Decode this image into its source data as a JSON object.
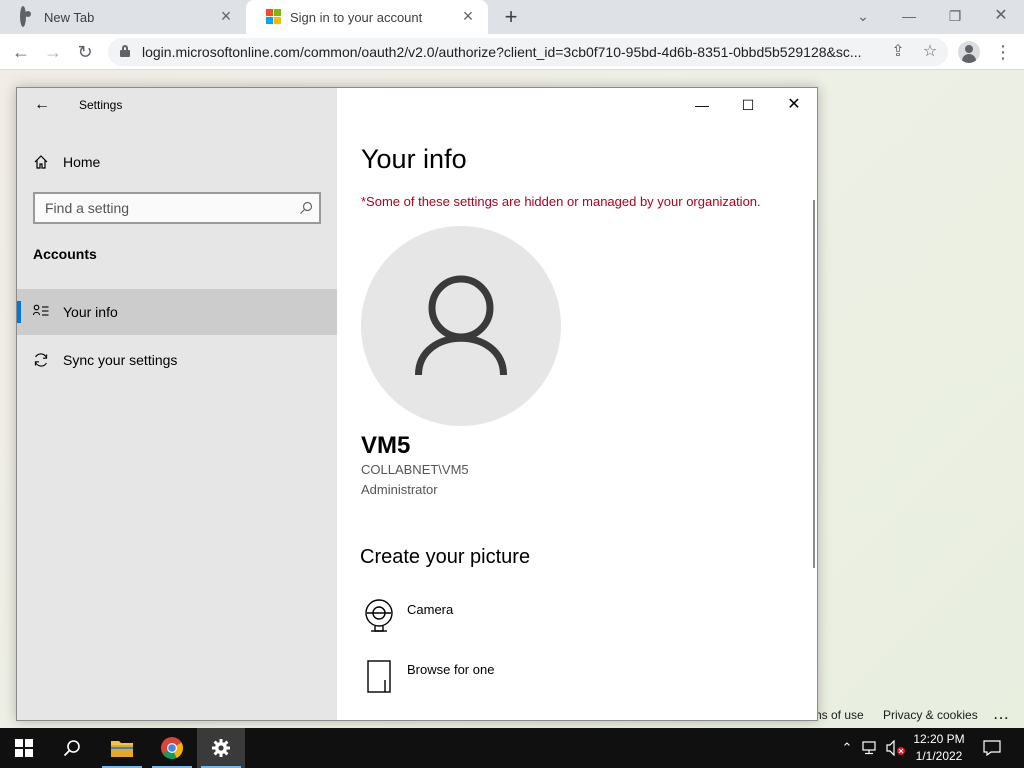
{
  "browser": {
    "tabs": [
      {
        "title": "New Tab",
        "active": false,
        "icon": "chrome-icon"
      },
      {
        "title": "Sign in to your account",
        "active": true,
        "icon": "microsoft-logo-icon"
      }
    ],
    "url": "login.microsoftonline.com/common/oauth2/v2.0/authorize?client_id=3cb0f710-95bd-4d6b-8351-0bbd5b529128&sc...",
    "footer_links": [
      "ns of use",
      "Privacy & cookies",
      "..."
    ]
  },
  "settings": {
    "app_title": "Settings",
    "sidebar": {
      "home_label": "Home",
      "search_placeholder": "Find a setting",
      "section_title": "Accounts",
      "items": [
        {
          "label": "Your info",
          "icon": "your-info-icon",
          "active": true
        },
        {
          "label": "Sync your settings",
          "icon": "sync-icon",
          "active": false
        }
      ]
    },
    "main": {
      "title": "Your info",
      "notice": "*Some of these settings are hidden or managed by your organization.",
      "user": {
        "name": "VM5",
        "account": "COLLABNET\\VM5",
        "role": "Administrator"
      },
      "create_picture_title": "Create your picture",
      "options": [
        {
          "label": "Camera",
          "icon": "camera-icon"
        },
        {
          "label": "Browse for one",
          "icon": "browse-file-icon"
        }
      ]
    }
  },
  "taskbar": {
    "time": "12:20 PM",
    "date": "1/1/2022"
  },
  "colors": {
    "accent": "#0078d7",
    "notice": "#b00020",
    "taskbar": "#101010"
  }
}
